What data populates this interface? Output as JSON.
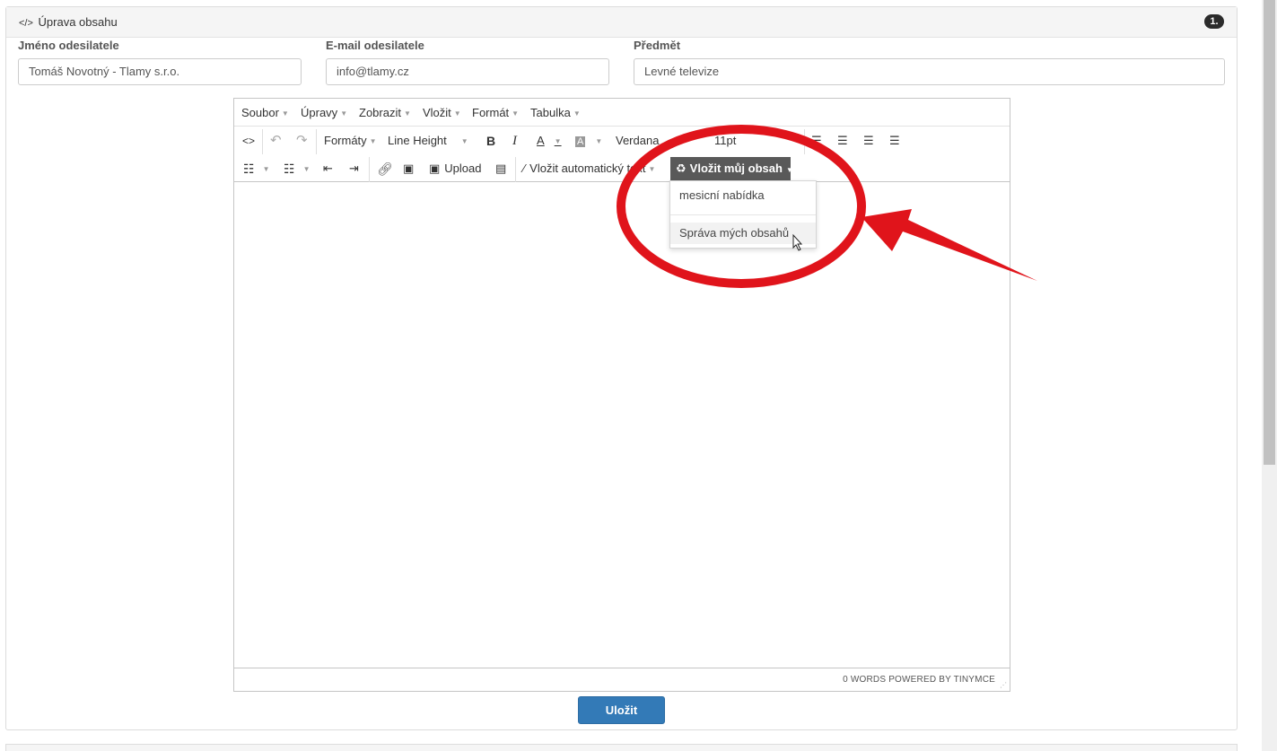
{
  "panel": {
    "title": "Úprava obsahu",
    "badge": "1."
  },
  "fields": {
    "sender_name_label": "Jméno odesilatele",
    "sender_name_value": "Tomáš Novotný - Tlamy s.r.o.",
    "sender_email_label": "E-mail odesilatele",
    "sender_email_value": "info@tlamy.cz",
    "subject_label": "Předmět",
    "subject_value": "Levné televize"
  },
  "menubar": {
    "items": [
      "Soubor",
      "Úpravy",
      "Zobrazit",
      "Vložit",
      "Formát",
      "Tabulka"
    ]
  },
  "toolbar": {
    "source_code": "<>",
    "formats": "Formáty",
    "line_height": "Line Height",
    "bold": "B",
    "italic": "I",
    "font_color": "A",
    "bg_color": "A",
    "font_family": "Verdana",
    "font_size": "11pt",
    "upload": "Upload",
    "auto_text": "Vložit automatický text",
    "my_content": "Vložit můj obsah"
  },
  "dropdown": {
    "items": [
      "mesicní nabídka",
      "Správa mých obsahů"
    ]
  },
  "statusbar": {
    "text": "0 WORDS POWERED BY TINYMCE"
  },
  "actions": {
    "save": "Uložit"
  },
  "colors": {
    "primary": "#337ab7",
    "annotation": "#e0141b",
    "dropdown_button": "#595959"
  }
}
